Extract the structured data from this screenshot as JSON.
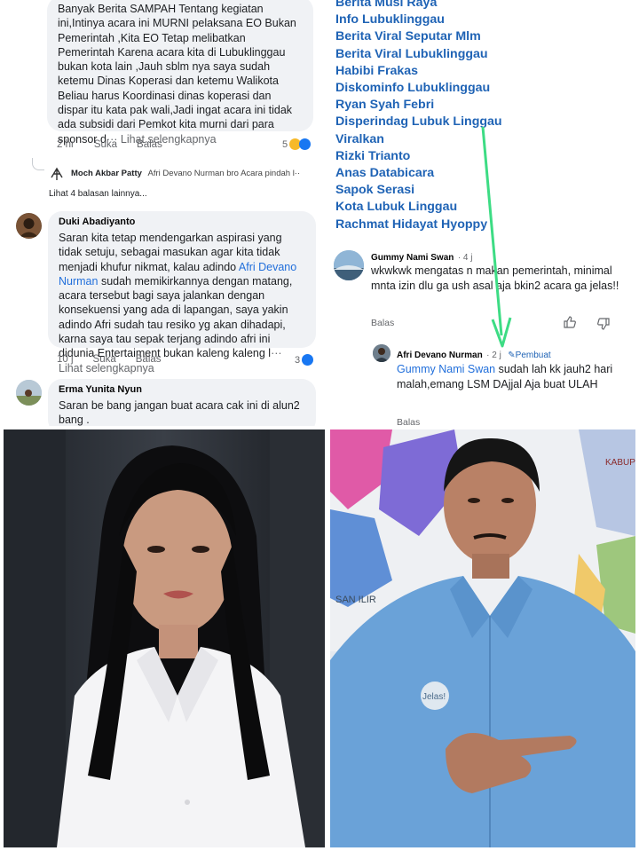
{
  "left_panel": {
    "comment1": {
      "text": "Banyak Berita SAMPAH Tentang kegiatan ini,Intinya acara ini MURNI pelaksana EO Bukan Pemerintah ,Kita EO Tetap melibatkan Pemerintah Karena acara kita di Lubuklinggau bukan kota lain ,Jauh sblm nya saya sudah ketemu Dinas Koperasi dan ketemu Walikota Beliau harus Koordinasi dinas koperasi dan dispar itu kata pak wali,Jadi ingat acara ini tidak ada subsidi dari Pemkot kita murni dari para sponsor d",
      "see_more": "··· Lihat selengkapnya",
      "time": "2 hr",
      "like": "Suka",
      "reply": "Balas",
      "reactions": "5"
    },
    "reply_preview": {
      "name": "Moch Akbar Patty",
      "text": "Afri Devano Nurman bro Acara pindah l··",
      "more_replies": "Lihat 4 balasan lainnya..."
    },
    "comment2": {
      "name": "Duki Abadiyanto",
      "text_before": "Saran kita tetap mendengarkan aspirasi yang tidak setuju, sebagai masukan agar kita tidak menjadi khufur nikmat, kalau adindo ",
      "mention": "Afri Devano Nurman",
      "text_after": " sudah memikirkannya dengan matang, acara tersebut bagi saya jalankan dengan konsekuensi yang ada di lapangan, saya yakin adindo Afri sudah tau resiko yg akan dihadapi, karna saya tau sepak terjang adindo afri ini didunia Entertaiment bukan kaleng kaleng l",
      "see_more": "··· Lihat selengkapnya",
      "time": "10 j",
      "like": "Suka",
      "reply": "Balas",
      "reactions": "3"
    },
    "comment3": {
      "name": "Erma Yunita Nyun",
      "text": "Saran be bang jangan buat acara cak ini di alun2 bang ."
    }
  },
  "right_panel": {
    "pages": [
      "Berita Musi Raya",
      "Info Lubuklinggau",
      "Berita Viral Seputar Mlm",
      "Berita Viral Lubuklinggau",
      "Habibi Frakas",
      "Diskominfo Lubuklinggau",
      "Ryan Syah Febri",
      "Disperindag Lubuk Linggau",
      "Viralkan",
      "Rizki Trianto",
      "Anas Databicara",
      "Sapok Serasi",
      "Kota Lubuk Linggau",
      "Rachmat Hidayat Hyoppy"
    ],
    "comment": {
      "name": "Gummy Nami Swan",
      "time": "· 4 j",
      "text": "wkwkwk mengatas n    makan pemerintah, minimal mnta izin dlu    ga ush asal aja bkin2 acara ga jelas!!",
      "reply": "Balas"
    },
    "reply": {
      "name": "Afri Devano Nurman",
      "time": "· 2 j",
      "badge": "Pembuat",
      "mention": "Gummy Nami Swan",
      "text": " sudah lah kk jauh2 hari malah,emang LSM DAjjal Aja buat ULAH",
      "reply": "Balas"
    },
    "arrow_color": "#3ddc84"
  },
  "photo_man": {
    "banner_text": "SAN ILIR",
    "banner_text2": "KABUP",
    "badge_text": "Jelas!"
  }
}
